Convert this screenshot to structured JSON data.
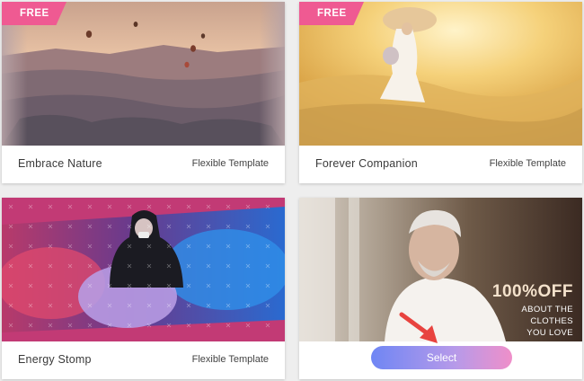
{
  "templates": [
    {
      "title": "Embrace Nature",
      "type": "Flexible Template",
      "badge": "FREE"
    },
    {
      "title": "Forever Companion",
      "type": "Flexible Template",
      "badge": "FREE"
    },
    {
      "title": "Energy Stomp",
      "type": "Flexible Template"
    },
    {
      "promo_headline": "100%OFF",
      "promo_line1": "ABOUT THE",
      "promo_line2": "CLOTHES",
      "promo_line3": "YOU LOVE",
      "select_label": "Select"
    }
  ],
  "colors": {
    "badge": "#ef5a92",
    "select_gradient_start": "#6f86f4",
    "select_gradient_end": "#ef8fc9",
    "arrow": "#e8433f"
  },
  "icons": [
    "pointer-arrow-icon"
  ]
}
